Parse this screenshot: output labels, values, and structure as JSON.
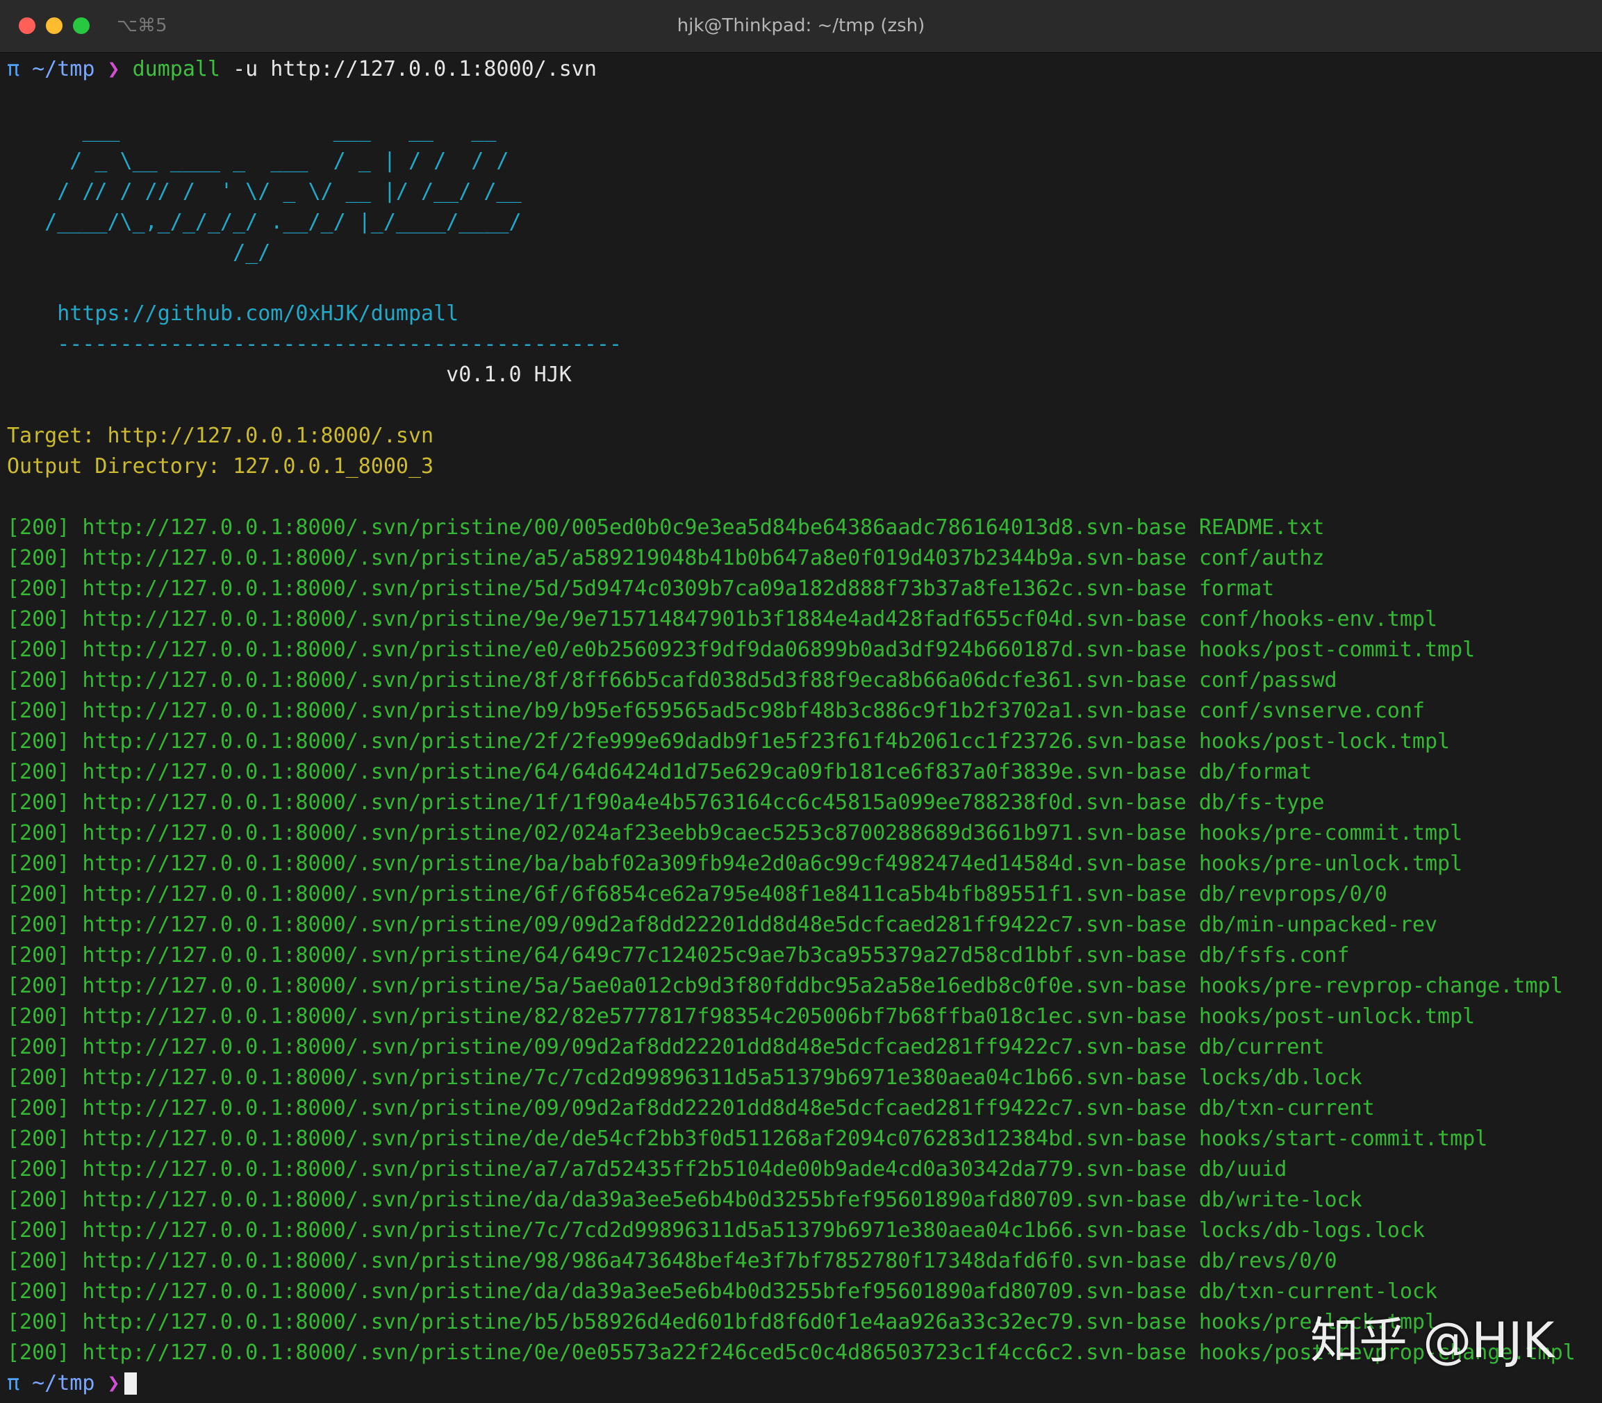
{
  "window": {
    "shortcut": "⌥⌘5",
    "title": "hjk@Thinkpad: ~/tmp (zsh)"
  },
  "prompt": {
    "symbol": "π",
    "cwd": "~/tmp",
    "arrow": "❯",
    "command": "dumpall",
    "args": " -u http://127.0.0.1:8000/.svn"
  },
  "banner": {
    "ascii": [
      "      ___                 ___   __   __",
      "     / _ \\__ ____ _  ___  / _ | / /  / /",
      "    / // / // /  ' \\/ _ \\/ __ |/ /__/ /__",
      "   /____/\\_,_/_/_/_/ .__/_/ |_/____/____/",
      "                  /_/"
    ],
    "url": "    https://github.com/0xHJK/dumpall",
    "rule": "    ---------------------------------------------",
    "version": "                                   v0.1.0 HJK"
  },
  "info": {
    "target": "Target: http://127.0.0.1:8000/.svn",
    "output": "Output Directory: 127.0.0.1_8000_3"
  },
  "results": [
    "[200] http://127.0.0.1:8000/.svn/pristine/00/005ed0b0c9e3ea5d84be64386aadc786164013d8.svn-base README.txt",
    "[200] http://127.0.0.1:8000/.svn/pristine/a5/a589219048b41b0b647a8e0f019d4037b2344b9a.svn-base conf/authz",
    "[200] http://127.0.0.1:8000/.svn/pristine/5d/5d9474c0309b7ca09a182d888f73b37a8fe1362c.svn-base format",
    "[200] http://127.0.0.1:8000/.svn/pristine/9e/9e715714847901b3f1884e4ad428fadf655cf04d.svn-base conf/hooks-env.tmpl",
    "[200] http://127.0.0.1:8000/.svn/pristine/e0/e0b2560923f9df9da06899b0ad3df924b660187d.svn-base hooks/post-commit.tmpl",
    "[200] http://127.0.0.1:8000/.svn/pristine/8f/8ff66b5cafd038d5d3f88f9eca8b66a06dcfe361.svn-base conf/passwd",
    "[200] http://127.0.0.1:8000/.svn/pristine/b9/b95ef659565ad5c98bf48b3c886c9f1b2f3702a1.svn-base conf/svnserve.conf",
    "[200] http://127.0.0.1:8000/.svn/pristine/2f/2fe999e69dadb9f1e5f23f61f4b2061cc1f23726.svn-base hooks/post-lock.tmpl",
    "[200] http://127.0.0.1:8000/.svn/pristine/64/64d6424d1d75e629ca09fb181ce6f837a0f3839e.svn-base db/format",
    "[200] http://127.0.0.1:8000/.svn/pristine/1f/1f90a4e4b5763164cc6c45815a099ee788238f0d.svn-base db/fs-type",
    "[200] http://127.0.0.1:8000/.svn/pristine/02/024af23eebb9caec5253c8700288689d3661b971.svn-base hooks/pre-commit.tmpl",
    "[200] http://127.0.0.1:8000/.svn/pristine/ba/babf02a309fb94e2d0a6c99cf4982474ed14584d.svn-base hooks/pre-unlock.tmpl",
    "[200] http://127.0.0.1:8000/.svn/pristine/6f/6f6854ce62a795e408f1e8411ca5b4bfb89551f1.svn-base db/revprops/0/0",
    "[200] http://127.0.0.1:8000/.svn/pristine/09/09d2af8dd22201dd8d48e5dcfcaed281ff9422c7.svn-base db/min-unpacked-rev",
    "[200] http://127.0.0.1:8000/.svn/pristine/64/649c77c124025c9ae7b3ca955379a27d58cd1bbf.svn-base db/fsfs.conf",
    "[200] http://127.0.0.1:8000/.svn/pristine/5a/5ae0a012cb9d3f80fddbc95a2a58e16edb8c0f0e.svn-base hooks/pre-revprop-change.tmpl",
    "[200] http://127.0.0.1:8000/.svn/pristine/82/82e5777817f98354c205006bf7b68ffba018c1ec.svn-base hooks/post-unlock.tmpl",
    "[200] http://127.0.0.1:8000/.svn/pristine/09/09d2af8dd22201dd8d48e5dcfcaed281ff9422c7.svn-base db/current",
    "[200] http://127.0.0.1:8000/.svn/pristine/7c/7cd2d99896311d5a51379b6971e380aea04c1b66.svn-base locks/db.lock",
    "[200] http://127.0.0.1:8000/.svn/pristine/09/09d2af8dd22201dd8d48e5dcfcaed281ff9422c7.svn-base db/txn-current",
    "[200] http://127.0.0.1:8000/.svn/pristine/de/de54cf2bb3f0d511268af2094c076283d12384bd.svn-base hooks/start-commit.tmpl",
    "[200] http://127.0.0.1:8000/.svn/pristine/a7/a7d52435ff2b5104de00b9ade4cd0a30342da779.svn-base db/uuid",
    "[200] http://127.0.0.1:8000/.svn/pristine/da/da39a3ee5e6b4b0d3255bfef95601890afd80709.svn-base db/write-lock",
    "[200] http://127.0.0.1:8000/.svn/pristine/7c/7cd2d99896311d5a51379b6971e380aea04c1b66.svn-base locks/db-logs.lock",
    "[200] http://127.0.0.1:8000/.svn/pristine/98/986a473648bef4e3f7bf7852780f17348dafd6f0.svn-base db/revs/0/0",
    "[200] http://127.0.0.1:8000/.svn/pristine/da/da39a3ee5e6b4b0d3255bfef95601890afd80709.svn-base db/txn-current-lock",
    "[200] http://127.0.0.1:8000/.svn/pristine/b5/b58926d4ed601bfd8f6d0f1e4aa926a33c32ec79.svn-base hooks/pre-lock.tmpl",
    "[200] http://127.0.0.1:8000/.svn/pristine/0e/0e05573a22f246ced5c0c4d86503723c1f4cc6c2.svn-base hooks/post-revprop-change.tmpl"
  ],
  "watermark": "知乎 @HJK",
  "colors": {
    "background": "#1a1a1a",
    "banner": "#22a8c8",
    "info": "#cdbb2f",
    "result": "#35b935",
    "prompt_path": "#7aa7ff",
    "prompt_arrow": "#d14fd1"
  }
}
